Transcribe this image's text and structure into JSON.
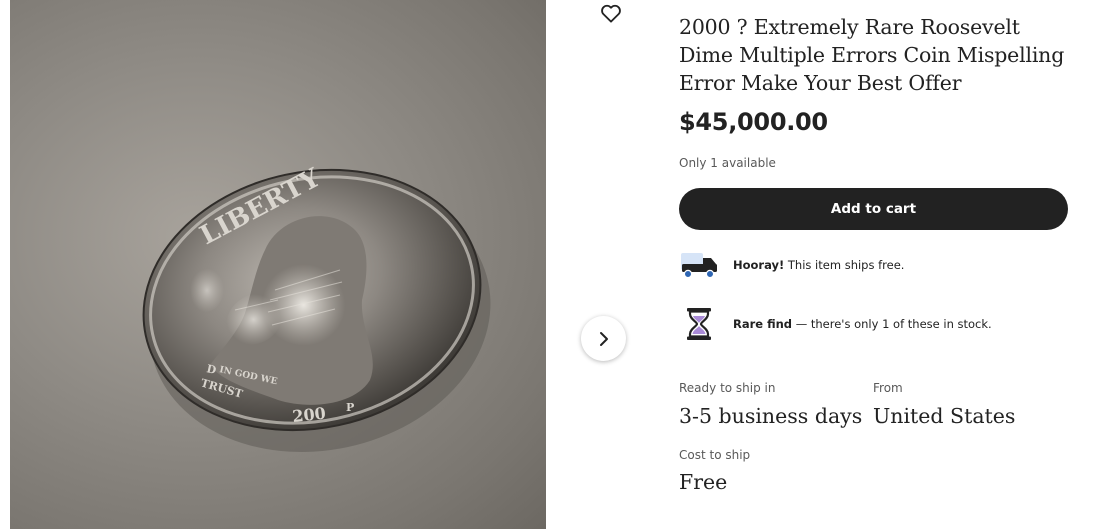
{
  "listing": {
    "title": "2000 ? Extremely Rare Roosevelt Dime Multiple Errors Coin Mispelling Error Make Your Best Offer",
    "price": "$45,000.00",
    "availability": "Only 1 available",
    "add_to_cart_label": "Add to cart"
  },
  "image": {
    "coin_text": [
      "LIBERTY",
      "D",
      "IN GOD WE",
      "TRUST",
      "200",
      "P"
    ]
  },
  "perks": [
    {
      "icon": "truck-icon",
      "strong": "Hooray!",
      "text": " This item ships free."
    },
    {
      "icon": "hourglass-icon",
      "strong": "Rare find",
      "text": " — there's only 1 of these in stock."
    }
  ],
  "shipping": {
    "ready_label": "Ready to ship in",
    "ready_value": "3-5 business days",
    "from_label": "From",
    "from_value": "United States",
    "cost_label": "Cost to ship",
    "cost_value": "Free"
  },
  "colors": {
    "button_bg": "#222222",
    "truck_blue": "#2f66b3",
    "hourglass_purple": "#a98bd6"
  }
}
